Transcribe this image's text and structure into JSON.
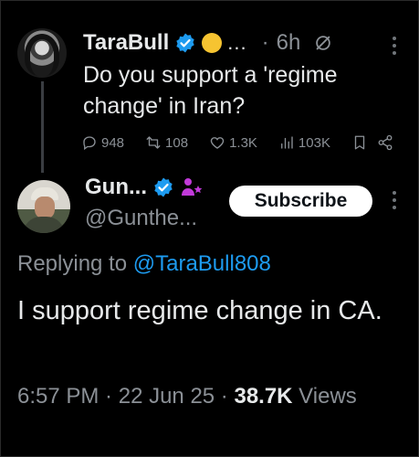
{
  "parent": {
    "name": "TaraBull",
    "ellipsis": "...",
    "separator": "·",
    "time": "6h",
    "text": "Do you support a 'regime change' in Iran?",
    "stats": {
      "replies": "948",
      "reposts": "108",
      "likes": "1.3K",
      "views": "103K"
    },
    "icons": [
      "verified-badge-icon",
      "yellow-emoji-icon",
      "grok-icon",
      "more-icon",
      "reply-icon",
      "repost-icon",
      "like-icon",
      "views-icon",
      "bookmark-icon",
      "share-icon"
    ]
  },
  "reply": {
    "name": "Gun...",
    "handle": "@Gunthe...",
    "subscribe_label": "Subscribe",
    "replying_prefix": "Replying to ",
    "replying_to": "@TaraBull808",
    "text": "I support regime change in CA.",
    "time": "6:57 PM",
    "sep1": " · ",
    "date": "22 Jun 25",
    "sep2": " · ",
    "views_count": "38.7K",
    "views_label": " Views"
  },
  "colors": {
    "background": "#000000",
    "text": "#e7e9ea",
    "secondary": "#8b9096",
    "link": "#1d9bf0",
    "verified": "#1d9bf0",
    "affiliate": "#c13ad9"
  }
}
